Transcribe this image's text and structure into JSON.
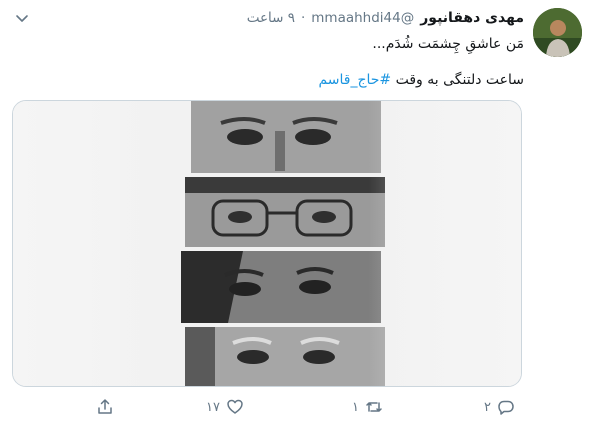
{
  "tweet": {
    "display_name": "مهدی دهقانپور",
    "handle": "@mmaahhdi44",
    "separator": "·",
    "time": "۹ ساعت",
    "text_line1": "مَن عاشقِ چِشمَت شُدَم...",
    "text_line2_prefix": "ساعت دلتنگی به وقت",
    "hashtag": "#حاج_قاسم"
  },
  "actions": {
    "reply_count": "۲",
    "retweet_count": "۱",
    "like_count": "۱۷"
  },
  "icons": {
    "more": "chevron-down-icon",
    "reply": "reply-icon",
    "retweet": "retweet-icon",
    "like": "heart-icon",
    "share": "share-icon"
  },
  "colors": {
    "link": "#1b95e0",
    "secondary": "#657786",
    "border": "#ccd6dd"
  }
}
